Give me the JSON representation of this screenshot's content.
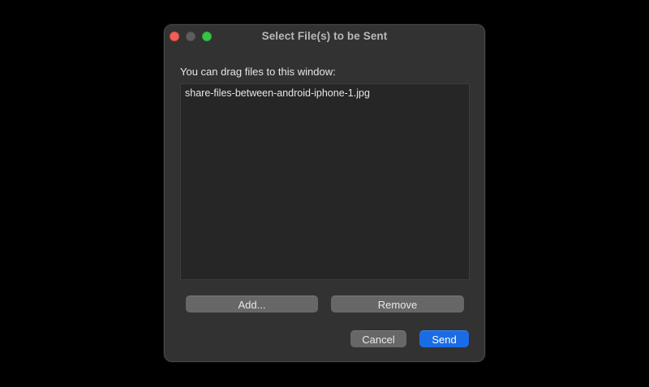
{
  "window": {
    "title": "Select File(s) to be Sent"
  },
  "traffic_lights": {
    "close_color": "#ee5f57",
    "minimize_color": "#5e5e5e",
    "maximize_color": "#39c24a"
  },
  "instruction": "You can drag files to this window:",
  "files": [
    "share-files-between-android-iphone-1.jpg"
  ],
  "buttons": {
    "add_label": "Add...",
    "remove_label": "Remove",
    "cancel_label": "Cancel",
    "send_label": "Send"
  },
  "colors": {
    "accent": "#1a6ce6",
    "window_bg": "#323232",
    "list_bg": "#262626"
  }
}
